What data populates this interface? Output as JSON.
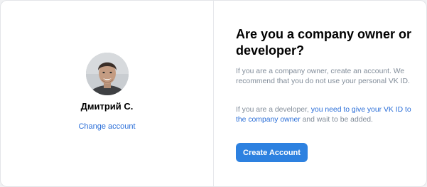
{
  "account": {
    "name": "Дмитрий С.",
    "change_label": "Change account",
    "avatar": "user-photo"
  },
  "prompt": {
    "title": "Are you a company owner or developer?",
    "owner_text": "If you are a company owner, create an account. We recommend that you do not use your personal VK ID.",
    "dev_text_before": "If you are a developer, ",
    "dev_link": "you need to give your VK ID to the company owner",
    "dev_text_after": " and wait to be added.",
    "create_button": "Create Account"
  },
  "colors": {
    "accent": "#2d81e0",
    "link": "#2a6ed8",
    "muted_text": "#818c99"
  }
}
